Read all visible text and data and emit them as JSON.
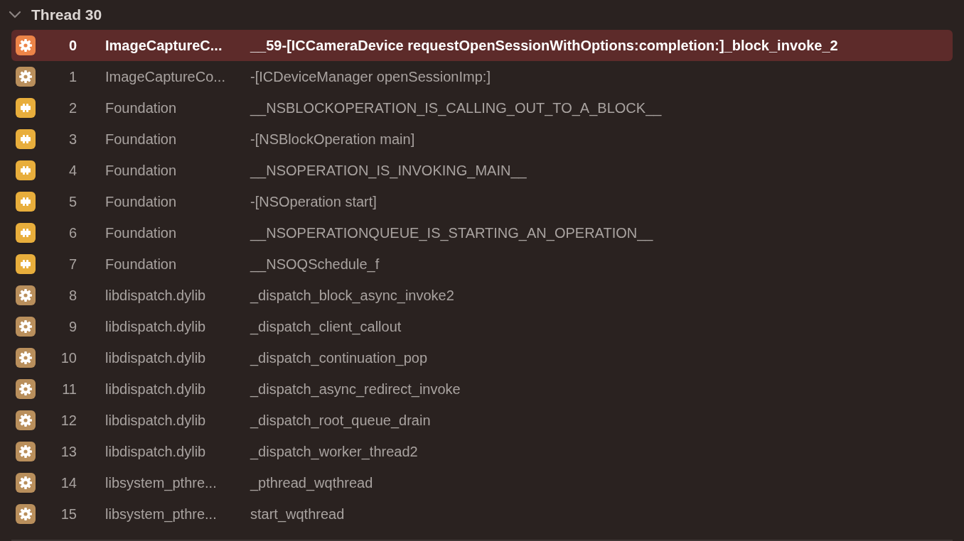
{
  "thread": {
    "title": "Thread 30",
    "expanded": true
  },
  "frames": [
    {
      "kind": "gear",
      "number": "0",
      "library": "ImageCaptureC...",
      "symbol": "__59-[ICCameraDevice requestOpenSessionWithOptions:completion:]_block_invoke_2",
      "selected": true
    },
    {
      "kind": "gear",
      "number": "1",
      "library": "ImageCaptureCo...",
      "symbol": "-[ICDeviceManager openSessionImp:]",
      "selected": false
    },
    {
      "kind": "puzzle",
      "number": "2",
      "library": "Foundation",
      "symbol": "__NSBLOCKOPERATION_IS_CALLING_OUT_TO_A_BLOCK__",
      "selected": false
    },
    {
      "kind": "puzzle",
      "number": "3",
      "library": "Foundation",
      "symbol": "-[NSBlockOperation main]",
      "selected": false
    },
    {
      "kind": "puzzle",
      "number": "4",
      "library": "Foundation",
      "symbol": "__NSOPERATION_IS_INVOKING_MAIN__",
      "selected": false
    },
    {
      "kind": "puzzle",
      "number": "5",
      "library": "Foundation",
      "symbol": "-[NSOperation start]",
      "selected": false
    },
    {
      "kind": "puzzle",
      "number": "6",
      "library": "Foundation",
      "symbol": "__NSOPERATIONQUEUE_IS_STARTING_AN_OPERATION__",
      "selected": false
    },
    {
      "kind": "puzzle",
      "number": "7",
      "library": "Foundation",
      "symbol": "__NSOQSchedule_f",
      "selected": false
    },
    {
      "kind": "gear",
      "number": "8",
      "library": "libdispatch.dylib",
      "symbol": "_dispatch_block_async_invoke2",
      "selected": false
    },
    {
      "kind": "gear",
      "number": "9",
      "library": "libdispatch.dylib",
      "symbol": "_dispatch_client_callout",
      "selected": false
    },
    {
      "kind": "gear",
      "number": "10",
      "library": "libdispatch.dylib",
      "symbol": "_dispatch_continuation_pop",
      "selected": false
    },
    {
      "kind": "gear",
      "number": "11",
      "library": "libdispatch.dylib",
      "symbol": "_dispatch_async_redirect_invoke",
      "selected": false
    },
    {
      "kind": "gear",
      "number": "12",
      "library": "libdispatch.dylib",
      "symbol": "_dispatch_root_queue_drain",
      "selected": false
    },
    {
      "kind": "gear",
      "number": "13",
      "library": "libdispatch.dylib",
      "symbol": "_dispatch_worker_thread2",
      "selected": false
    },
    {
      "kind": "gear",
      "number": "14",
      "library": "libsystem_pthre...",
      "symbol": "_pthread_wqthread",
      "selected": false
    },
    {
      "kind": "gear",
      "number": "15",
      "library": "libsystem_pthre...",
      "symbol": "start_wqthread",
      "selected": false
    }
  ]
}
